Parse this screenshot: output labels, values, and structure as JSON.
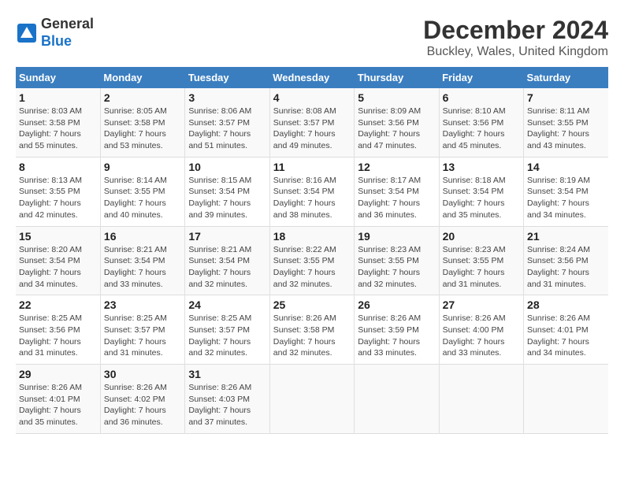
{
  "logo": {
    "line1": "General",
    "line2": "Blue"
  },
  "title": "December 2024",
  "subtitle": "Buckley, Wales, United Kingdom",
  "days_of_week": [
    "Sunday",
    "Monday",
    "Tuesday",
    "Wednesday",
    "Thursday",
    "Friday",
    "Saturday"
  ],
  "weeks": [
    [
      {
        "day": "1",
        "info": "Sunrise: 8:03 AM\nSunset: 3:58 PM\nDaylight: 7 hours\nand 55 minutes."
      },
      {
        "day": "2",
        "info": "Sunrise: 8:05 AM\nSunset: 3:58 PM\nDaylight: 7 hours\nand 53 minutes."
      },
      {
        "day": "3",
        "info": "Sunrise: 8:06 AM\nSunset: 3:57 PM\nDaylight: 7 hours\nand 51 minutes."
      },
      {
        "day": "4",
        "info": "Sunrise: 8:08 AM\nSunset: 3:57 PM\nDaylight: 7 hours\nand 49 minutes."
      },
      {
        "day": "5",
        "info": "Sunrise: 8:09 AM\nSunset: 3:56 PM\nDaylight: 7 hours\nand 47 minutes."
      },
      {
        "day": "6",
        "info": "Sunrise: 8:10 AM\nSunset: 3:56 PM\nDaylight: 7 hours\nand 45 minutes."
      },
      {
        "day": "7",
        "info": "Sunrise: 8:11 AM\nSunset: 3:55 PM\nDaylight: 7 hours\nand 43 minutes."
      }
    ],
    [
      {
        "day": "8",
        "info": "Sunrise: 8:13 AM\nSunset: 3:55 PM\nDaylight: 7 hours\nand 42 minutes."
      },
      {
        "day": "9",
        "info": "Sunrise: 8:14 AM\nSunset: 3:55 PM\nDaylight: 7 hours\nand 40 minutes."
      },
      {
        "day": "10",
        "info": "Sunrise: 8:15 AM\nSunset: 3:54 PM\nDaylight: 7 hours\nand 39 minutes."
      },
      {
        "day": "11",
        "info": "Sunrise: 8:16 AM\nSunset: 3:54 PM\nDaylight: 7 hours\nand 38 minutes."
      },
      {
        "day": "12",
        "info": "Sunrise: 8:17 AM\nSunset: 3:54 PM\nDaylight: 7 hours\nand 36 minutes."
      },
      {
        "day": "13",
        "info": "Sunrise: 8:18 AM\nSunset: 3:54 PM\nDaylight: 7 hours\nand 35 minutes."
      },
      {
        "day": "14",
        "info": "Sunrise: 8:19 AM\nSunset: 3:54 PM\nDaylight: 7 hours\nand 34 minutes."
      }
    ],
    [
      {
        "day": "15",
        "info": "Sunrise: 8:20 AM\nSunset: 3:54 PM\nDaylight: 7 hours\nand 34 minutes."
      },
      {
        "day": "16",
        "info": "Sunrise: 8:21 AM\nSunset: 3:54 PM\nDaylight: 7 hours\nand 33 minutes."
      },
      {
        "day": "17",
        "info": "Sunrise: 8:21 AM\nSunset: 3:54 PM\nDaylight: 7 hours\nand 32 minutes."
      },
      {
        "day": "18",
        "info": "Sunrise: 8:22 AM\nSunset: 3:55 PM\nDaylight: 7 hours\nand 32 minutes."
      },
      {
        "day": "19",
        "info": "Sunrise: 8:23 AM\nSunset: 3:55 PM\nDaylight: 7 hours\nand 32 minutes."
      },
      {
        "day": "20",
        "info": "Sunrise: 8:23 AM\nSunset: 3:55 PM\nDaylight: 7 hours\nand 31 minutes."
      },
      {
        "day": "21",
        "info": "Sunrise: 8:24 AM\nSunset: 3:56 PM\nDaylight: 7 hours\nand 31 minutes."
      }
    ],
    [
      {
        "day": "22",
        "info": "Sunrise: 8:25 AM\nSunset: 3:56 PM\nDaylight: 7 hours\nand 31 minutes."
      },
      {
        "day": "23",
        "info": "Sunrise: 8:25 AM\nSunset: 3:57 PM\nDaylight: 7 hours\nand 31 minutes."
      },
      {
        "day": "24",
        "info": "Sunrise: 8:25 AM\nSunset: 3:57 PM\nDaylight: 7 hours\nand 32 minutes."
      },
      {
        "day": "25",
        "info": "Sunrise: 8:26 AM\nSunset: 3:58 PM\nDaylight: 7 hours\nand 32 minutes."
      },
      {
        "day": "26",
        "info": "Sunrise: 8:26 AM\nSunset: 3:59 PM\nDaylight: 7 hours\nand 33 minutes."
      },
      {
        "day": "27",
        "info": "Sunrise: 8:26 AM\nSunset: 4:00 PM\nDaylight: 7 hours\nand 33 minutes."
      },
      {
        "day": "28",
        "info": "Sunrise: 8:26 AM\nSunset: 4:01 PM\nDaylight: 7 hours\nand 34 minutes."
      }
    ],
    [
      {
        "day": "29",
        "info": "Sunrise: 8:26 AM\nSunset: 4:01 PM\nDaylight: 7 hours\nand 35 minutes."
      },
      {
        "day": "30",
        "info": "Sunrise: 8:26 AM\nSunset: 4:02 PM\nDaylight: 7 hours\nand 36 minutes."
      },
      {
        "day": "31",
        "info": "Sunrise: 8:26 AM\nSunset: 4:03 PM\nDaylight: 7 hours\nand 37 minutes."
      },
      {
        "day": "",
        "info": ""
      },
      {
        "day": "",
        "info": ""
      },
      {
        "day": "",
        "info": ""
      },
      {
        "day": "",
        "info": ""
      }
    ]
  ]
}
